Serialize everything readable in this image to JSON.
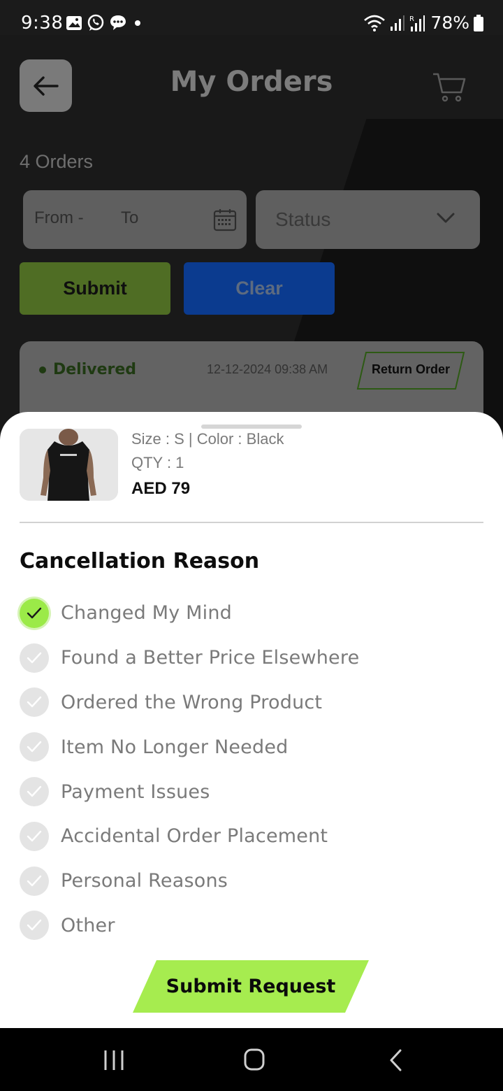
{
  "status_bar": {
    "time": "9:38",
    "battery": "78%",
    "icons": [
      "gallery-icon",
      "whatsapp-icon",
      "message-icon",
      "dot-icon",
      "wifi-icon",
      "signal-icon",
      "signal-roaming-icon",
      "battery-icon"
    ]
  },
  "header": {
    "title": "My Orders",
    "back_icon": "back-arrow-icon",
    "cart_icon": "cart-icon"
  },
  "filters": {
    "order_count": "4 Orders",
    "from_label": "From -",
    "to_label": "To",
    "status_placeholder": "Status",
    "submit_label": "Submit",
    "clear_label": "Clear"
  },
  "order_card": {
    "status": "Delivered",
    "date": "12-12-2024 09:38 AM",
    "return_label": "Return Order"
  },
  "sheet": {
    "product": {
      "size_color": "Size : S | Color : Black",
      "qty": "QTY : 1",
      "price": "AED 79"
    },
    "section_title": "Cancellation Reason",
    "reasons": [
      {
        "label": "Changed My Mind",
        "selected": true
      },
      {
        "label": "Found a Better Price Elsewhere",
        "selected": false
      },
      {
        "label": "Ordered the Wrong Product",
        "selected": false
      },
      {
        "label": "Item No Longer Needed",
        "selected": false
      },
      {
        "label": "Payment Issues",
        "selected": false
      },
      {
        "label": "Accidental Order Placement",
        "selected": false
      },
      {
        "label": "Personal Reasons",
        "selected": false
      },
      {
        "label": "Other",
        "selected": false
      }
    ],
    "submit_request_label": "Submit Request"
  },
  "colors": {
    "accent": "#9bea48",
    "clear_blue": "#0b3b8f",
    "sheet_bg": "#ffffff"
  }
}
